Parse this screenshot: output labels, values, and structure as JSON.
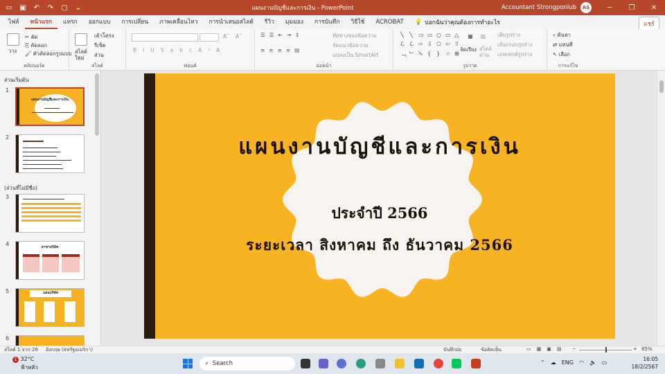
{
  "titlebar": {
    "doc_title": "แผนงานบัญชีและการเงิน  -  PowerPoint",
    "user_name": "Accountant Strongponlub",
    "avatar_initials": "AS",
    "accent": "#b7472a"
  },
  "tabs": [
    "ไฟล์",
    "หน้าแรก",
    "แทรก",
    "ออกแบบ",
    "การเปลี่ยน",
    "ภาพเคลื่อนไหว",
    "การนำเสนอสไลด์",
    "รีวิว",
    "มุมมอง",
    "การบันทึก",
    "วิธีใช้",
    "ACROBAT"
  ],
  "active_tab": "หน้าแรก",
  "tellme": "บอกฉันว่าคุณต้องการทำอะไร",
  "share_label": "แชร์",
  "ribbon": {
    "paste": "วาง",
    "cut": "ตัด",
    "copy": "คัดลอก",
    "format_painter": "ตัวคัดลอกรูปแบบ",
    "clipboard_label": "คลิปบอร์ด",
    "new_slide": "สไลด์ใหม่",
    "layout": "เค้าโครง",
    "reset": "รีเซ็ต",
    "section": "ส่วน",
    "slides_label": "สไลด์",
    "font_label": "ฟอนต์",
    "text_direction": "ทิศทางของข้อความ",
    "align_text": "จัดแนวข้อความ",
    "smartart": "แปลงเป็น SmartArt",
    "paragraph_label": "ย่อหน้า",
    "arrange": "จัดเรียง",
    "quick_styles": "สไตล์ด่วน",
    "shape_fill": "เติมรูปร่าง",
    "shape_outline": "เส้นกรอบรูปร่าง",
    "shape_effects": "เอฟเฟกต์รูปร่าง",
    "drawing_label": "รูปวาด",
    "find": "ค้นหา",
    "replace": "แทนที่",
    "select": "เลือก",
    "editing_label": "การแก้ไข"
  },
  "panel": {
    "section1": "ส่วนเริ่มต้น",
    "section2": "(ส่วนที่ไม่มีชื่อ)",
    "slide_numbers": [
      "1",
      "2",
      "3",
      "4",
      "5",
      "6"
    ],
    "thumb1_title": "แผนงานบัญชีและการเงิน",
    "thumb4_title": "สาขาบริษัท",
    "thumb5_title": "แผนบริษัท"
  },
  "slide": {
    "title": "แผนงานบัญชีและการเงิน",
    "subtitle1": "ประจำปี 2566",
    "subtitle2": "ระยะเวลา สิงหาคม ถึง ธันวาคม 2566",
    "bg_color": "#f8b323",
    "bar_color": "#2b1d0f"
  },
  "status": {
    "slide_of": "สไลด์ 1 จาก 26",
    "language": "อังกฤษ (สหรัฐอเมริกา)",
    "notes": "บันทึกย่อ",
    "comments": "ข้อคิดเห็น",
    "zoom": "85%"
  },
  "taskbar": {
    "temp": "32°C",
    "weather": "ฟ้าหลัว",
    "weather_badge": "1",
    "search": "Search",
    "lang": "ENG",
    "time": "16:05",
    "date": "18/2/2567"
  }
}
